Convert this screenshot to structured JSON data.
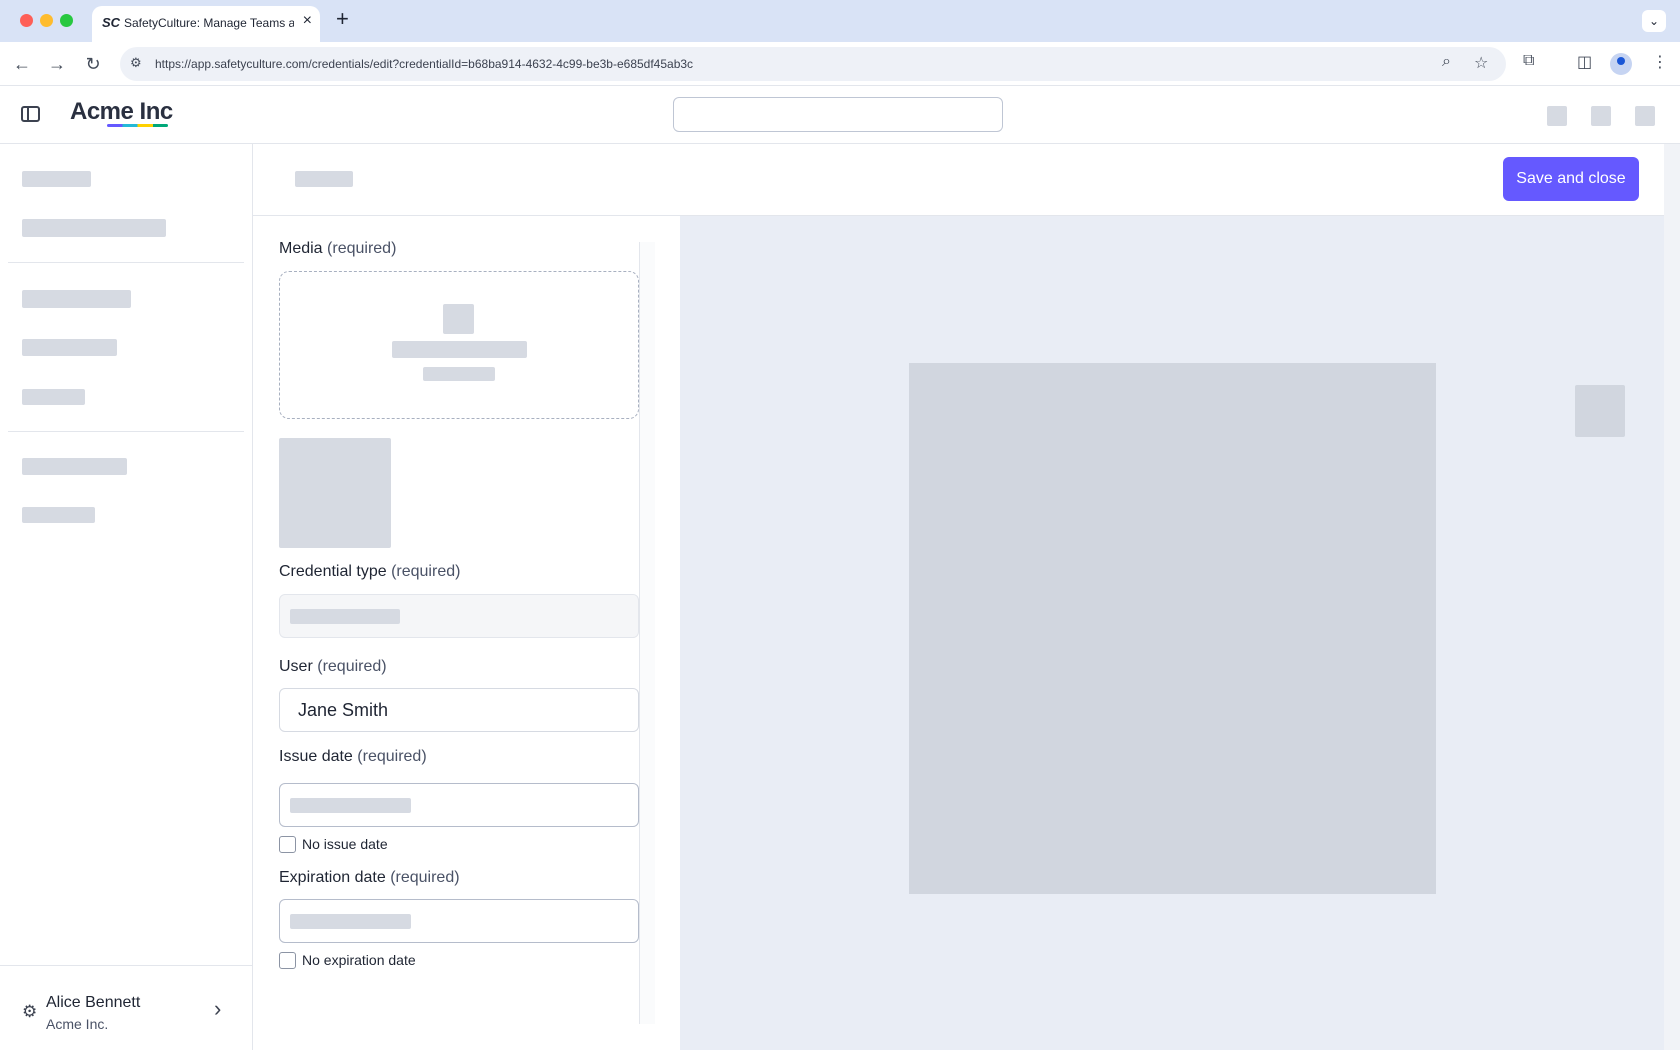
{
  "browser": {
    "tab_title": "SafetyCulture: Manage Teams and...",
    "favicon_text": "SC",
    "url": "https://app.safetyculture.com/credentials/edit?credentialId=b68ba914-4632-4c99-be3b-e685df45ab3c"
  },
  "app": {
    "logo": "Acme Inc",
    "brand_colors": [
      "#6559ff",
      "#24b9d7",
      "#ffd100",
      "#00a879"
    ]
  },
  "header": {
    "save_label": "Save and close",
    "save_color": "#6559ff"
  },
  "form": {
    "media": {
      "label": "Media",
      "req": "(required)"
    },
    "credential_type": {
      "label": "Credential type",
      "req": "(required)"
    },
    "user": {
      "label": "User",
      "req": "(required)",
      "value": "Jane Smith"
    },
    "issue_date": {
      "label": "Issue date",
      "req": "(required)",
      "checkbox": "No issue date"
    },
    "expiration_date": {
      "label": "Expiration date",
      "req": "(required)",
      "checkbox": "No expiration date"
    }
  },
  "sidebar": {
    "user_name": "Alice Bennett",
    "user_org": "Acme Inc."
  }
}
